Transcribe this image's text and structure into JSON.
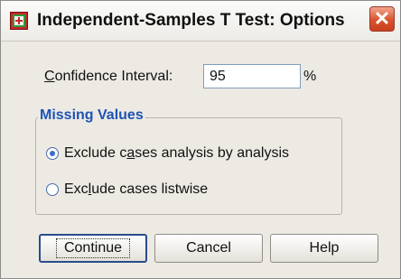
{
  "window": {
    "title": "Independent-Samples T Test: Options",
    "close_symbol": "✕"
  },
  "confidence_interval": {
    "label_mnemonic": "C",
    "label_rest": "onfidence Interval:",
    "value": "95",
    "unit": "%"
  },
  "missing_values": {
    "legend": "Missing Values",
    "options": [
      {
        "pre": "Exclude c",
        "mnemonic": "a",
        "post": "ses analysis by analysis",
        "selected": true
      },
      {
        "pre": "Exc",
        "mnemonic": "l",
        "post": "ude cases listwise",
        "selected": false
      }
    ]
  },
  "buttons": {
    "continue": "Continue",
    "cancel": "Cancel",
    "help": "Help"
  },
  "icons": {
    "app": "spss-dialog-icon",
    "close": "close-icon"
  },
  "colors": {
    "group_legend": "#1f53b5",
    "close_button": "#d9532c",
    "dialog_bg": "#eceae3"
  }
}
